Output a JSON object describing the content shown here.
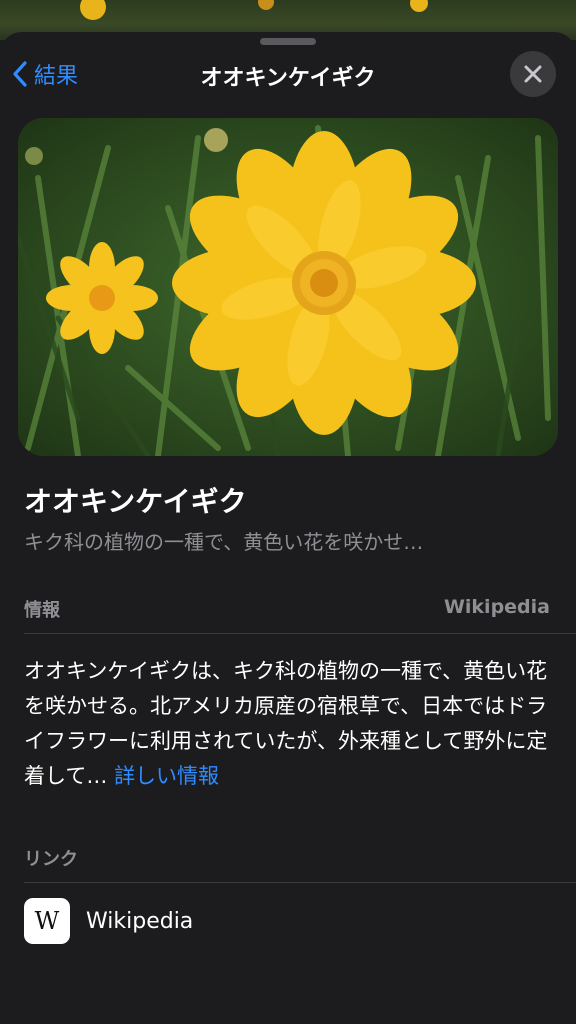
{
  "nav": {
    "back_label": "結果",
    "title": "オオキンケイギク"
  },
  "photo": {
    "subject": "yellow coreopsis flowers in grass"
  },
  "item": {
    "title": "オオキンケイギク",
    "subtitle": "キク科の植物の一種で、黄色い花を咲かせ…"
  },
  "info": {
    "label": "情報",
    "source": "Wikipedia",
    "description": "オオキンケイギクは、キク科の植物の一種で、黄色い花を咲かせる。北アメリカ原産の宿根草で、日本ではドライフラワーに利用されていたが、外来種として野外に定着して…",
    "more_link": "詳しい情報"
  },
  "links": {
    "label": "リンク",
    "items": [
      {
        "badge": "W",
        "label": "Wikipedia",
        "icon": "wikipedia-icon"
      }
    ]
  },
  "colors": {
    "accent": "#2f8cff",
    "background": "#1c1c1e",
    "secondary_text": "#8e8e93",
    "flower": "#f5c21b"
  }
}
